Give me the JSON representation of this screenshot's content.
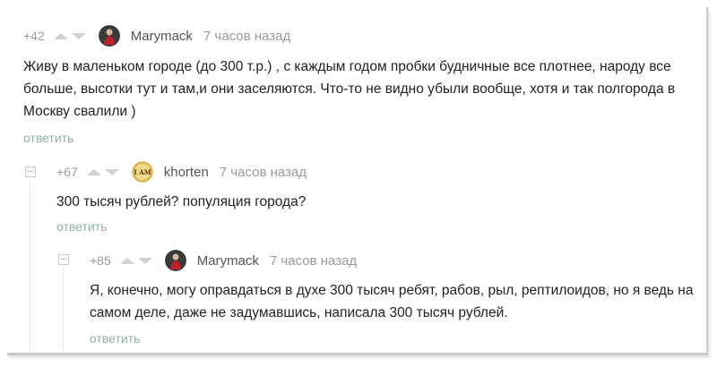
{
  "comments": [
    {
      "rating": "+42",
      "author": "Marymack",
      "time": "7 часов назад",
      "text": "Живу в маленьком городе (до 300 т.р.) , с каждым годом пробки будничные все плотнее, народу все больше, высотки тут и там,и они заселяются. Что-то не видно убыли вообще, хотя и так полгорода в Москву свалили )",
      "reply_label": "ответить",
      "avatar_icon": "red-figure-avatar"
    },
    {
      "rating": "+67",
      "author": "khorten",
      "time": "7 часов назад",
      "text": "300 тысяч рублей? популяция города?",
      "reply_label": "ответить",
      "avatar_icon": "i-am-badge-avatar",
      "avatar_text": "I AM"
    },
    {
      "rating": "+85",
      "author": "Marymack",
      "time": "7 часов назад",
      "text": "Я, конечно, могу оправдаться в духе 300 тысяч ребят, рабов, рыл, рептилоидов, но я ведь на самом деле, даже не задумавшись, написала 300 тысяч рублей.",
      "reply_label": "ответить",
      "avatar_icon": "red-figure-avatar"
    }
  ],
  "colors": {
    "reply_link": "#8fb0a6",
    "muted_text": "#9a9a9a",
    "author_text": "#555555",
    "arrow": "#d0d0d0"
  }
}
